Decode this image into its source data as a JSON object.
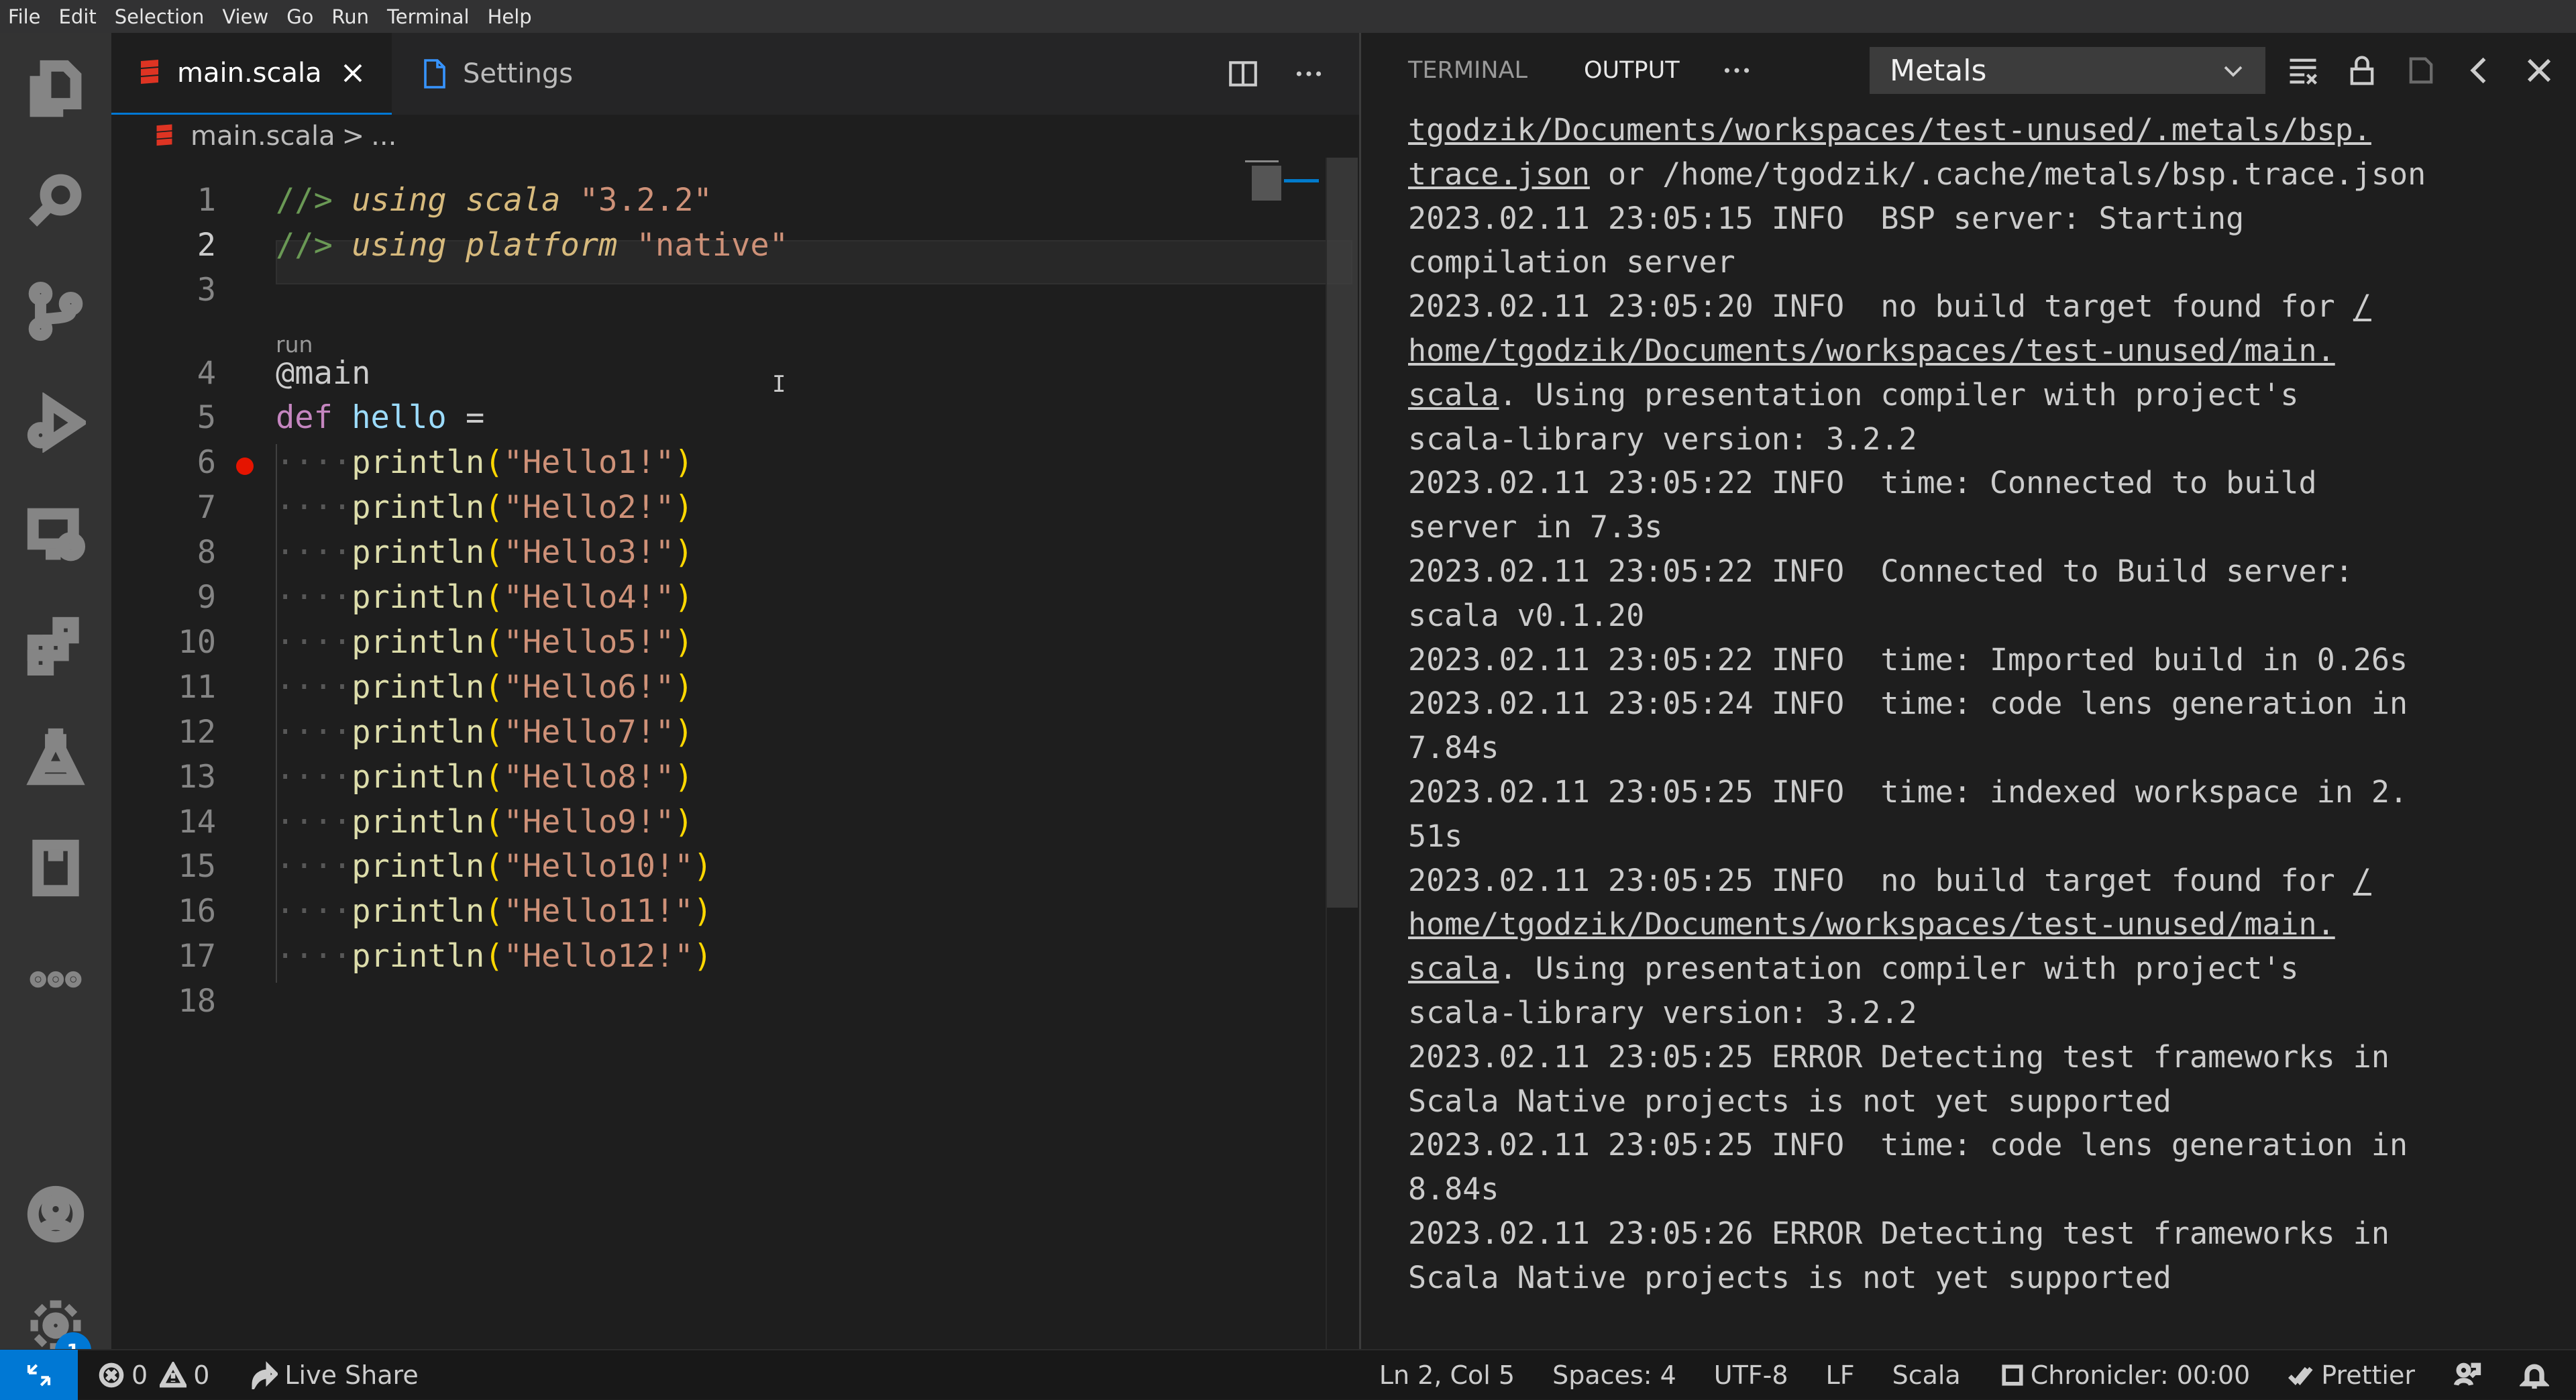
{
  "menu": [
    "File",
    "Edit",
    "Selection",
    "View",
    "Go",
    "Run",
    "Terminal",
    "Help"
  ],
  "tabs": {
    "main": "main.scala",
    "settings": "Settings"
  },
  "breadcrumb": {
    "file": "main.scala",
    "sep": ">",
    "rest": "..."
  },
  "editor": {
    "codelens": "run",
    "lines": [
      {
        "n": "1",
        "type": "dir",
        "kw": "using scala",
        "val": "\"3.2.2\""
      },
      {
        "n": "2",
        "type": "dir",
        "kw": "using platform",
        "val": "\"native\""
      },
      {
        "n": "3",
        "text": ""
      },
      {
        "n": "4",
        "text": "@main"
      },
      {
        "n": "5",
        "kw": "def",
        "name": "hello",
        "rest": "="
      },
      {
        "n": "6",
        "s": "\"Hello1!\""
      },
      {
        "n": "7",
        "s": "\"Hello2!\""
      },
      {
        "n": "8",
        "s": "\"Hello3!\""
      },
      {
        "n": "9",
        "s": "\"Hello4!\""
      },
      {
        "n": "10",
        "s": "\"Hello5!\""
      },
      {
        "n": "11",
        "s": "\"Hello6!\""
      },
      {
        "n": "12",
        "s": "\"Hello7!\""
      },
      {
        "n": "13",
        "s": "\"Hello8!\""
      },
      {
        "n": "14",
        "s": "\"Hello9!\""
      },
      {
        "n": "15",
        "s": "\"Hello10!\""
      },
      {
        "n": "16",
        "s": "\"Hello11!\""
      },
      {
        "n": "17",
        "s": "\"Hello12!\""
      },
      {
        "n": "18",
        "text": ""
      }
    ],
    "directive_prefix": "//>",
    "println": "println"
  },
  "panel": {
    "tabs": [
      "TERMINAL",
      "OUTPUT"
    ],
    "channel": "Metals",
    "output": [
      "tgodzik/Documents/workspaces/test-unused/.metals/bsp.",
      "trace.json or /home/tgodzik/.cache/metals/bsp.trace.json",
      "2023.02.11 23:05:15 INFO  BSP server: Starting",
      "compilation server",
      "2023.02.11 23:05:20 INFO  no build target found for /",
      "home/tgodzik/Documents/workspaces/test-unused/main.",
      "scala. Using presentation compiler with project's",
      "scala-library version: 3.2.2",
      "2023.02.11 23:05:22 INFO  time: Connected to build",
      "server in 7.3s",
      "2023.02.11 23:05:22 INFO  Connected to Build server:",
      "scala v0.1.20",
      "2023.02.11 23:05:22 INFO  time: Imported build in 0.26s",
      "2023.02.11 23:05:24 INFO  time: code lens generation in",
      "7.84s",
      "2023.02.11 23:05:25 INFO  time: indexed workspace in 2.",
      "51s",
      "2023.02.11 23:05:25 INFO  no build target found for /",
      "home/tgodzik/Documents/workspaces/test-unused/main.",
      "scala. Using presentation compiler with project's",
      "scala-library version: 3.2.2",
      "2023.02.11 23:05:25 ERROR Detecting test frameworks in",
      "Scala Native projects is not yet supported",
      "2023.02.11 23:05:25 INFO  time: code lens generation in",
      "8.84s",
      "2023.02.11 23:05:26 ERROR Detecting test frameworks in",
      "Scala Native projects is not yet supported"
    ]
  },
  "status": {
    "errors": "0",
    "warnings": "0",
    "liveshare": "Live Share",
    "position": "Ln 2, Col 5",
    "spaces": "Spaces: 4",
    "encoding": "UTF-8",
    "eol": "LF",
    "lang": "Scala",
    "chronicler": "Chronicler: 00:00",
    "prettier": "Prettier"
  },
  "settings_badge": "1"
}
